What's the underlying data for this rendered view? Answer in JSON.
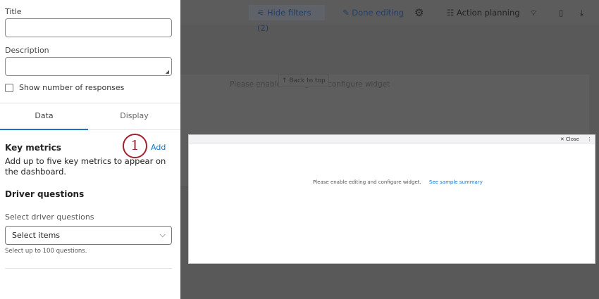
{
  "sidebar": {
    "title_label": "Title",
    "title_value": "",
    "description_label": "Description",
    "description_value": "",
    "show_responses_label": "Show number of responses",
    "tabs": [
      {
        "label": "Data"
      },
      {
        "label": "Display"
      }
    ],
    "key_metrics_heading": "Key metrics",
    "add_label": "Add",
    "annotation_number": "1",
    "key_metrics_desc": "Add up to five key metrics to appear on the dashboard.",
    "driver_heading": "Driver questions",
    "select_driver_label": "Select driver questions",
    "select_value": "Select items",
    "select_hint": "Select up to 100 questions."
  },
  "toolbar": {
    "hide_filters": "Hide filters (2)",
    "done_editing": "Done editing",
    "action_planning": "Action planning"
  },
  "background": {
    "placeholder": "Please enable editing and configure widget",
    "back_to_top": "↑ Back to top"
  },
  "widget": {
    "close": "Close",
    "message": "Please enable editing and configure widget.",
    "sample_link": "See sample summary"
  }
}
